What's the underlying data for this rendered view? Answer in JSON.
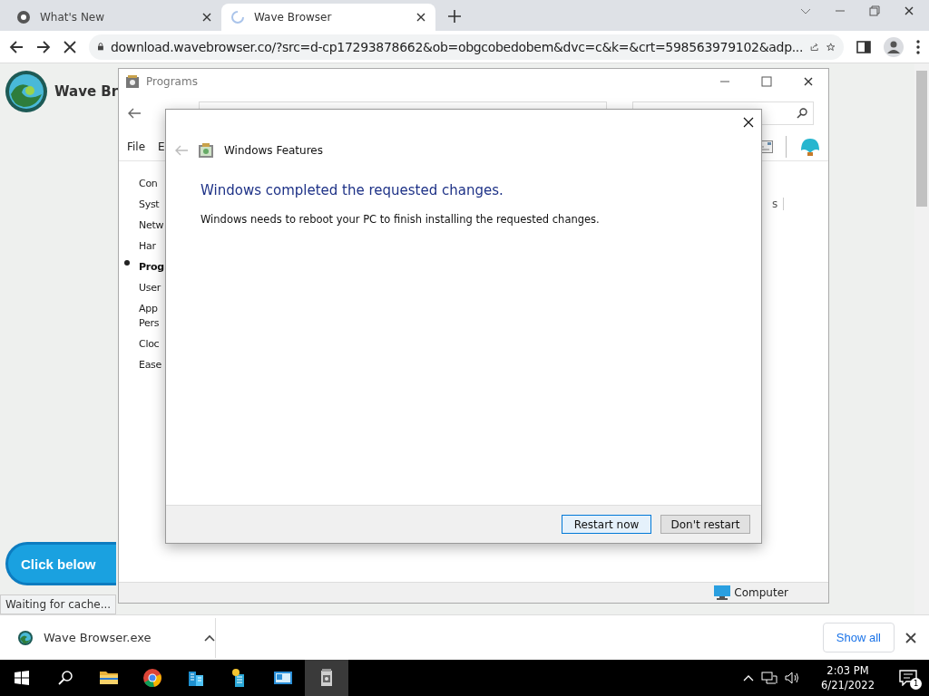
{
  "browser": {
    "tabs": [
      {
        "title": "What's New",
        "selected": false,
        "loading": false
      },
      {
        "title": "Wave Browser",
        "selected": true,
        "loading": true
      }
    ],
    "url": "download.wavebrowser.co/?src=d-cp17293878662&ob=obgcobedobem&dvc=c&k=&crt=598563979102&adp...",
    "page": {
      "brand": "Wave Br",
      "cta": "Click below",
      "status": "Waiting for cache..."
    }
  },
  "programs_window": {
    "title": "Programs",
    "menu": [
      "File",
      "E"
    ],
    "nav_items": [
      {
        "label": "Con",
        "selected": false
      },
      {
        "label": "Syst",
        "selected": false
      },
      {
        "label": "Netw",
        "selected": false
      },
      {
        "label": "Har",
        "selected": false
      },
      {
        "label": "Prog",
        "selected": true
      },
      {
        "label": "User",
        "selected": false
      },
      {
        "label": "App\nPers",
        "selected": false
      },
      {
        "label": "Cloc",
        "selected": false
      },
      {
        "label": "Ease",
        "selected": false
      }
    ],
    "fragment": "s",
    "status_bar": {
      "location": "Computer"
    }
  },
  "dialog": {
    "title": "Windows Features",
    "heading": "Windows completed the requested changes.",
    "message": "Windows needs to reboot your PC to finish installing the requested changes.",
    "buttons": [
      {
        "label": "Restart now",
        "default": true
      },
      {
        "label": "Don't restart",
        "default": false
      }
    ]
  },
  "downloads": {
    "file": "Wave Browser.exe",
    "show_all": "Show all"
  },
  "taskbar": {
    "apps": [
      {
        "kind": "explorer",
        "active": false
      },
      {
        "kind": "chrome",
        "active": false
      },
      {
        "kind": "server",
        "active": false
      },
      {
        "kind": "tower",
        "active": false
      },
      {
        "kind": "panel",
        "active": false
      },
      {
        "kind": "programs",
        "active": true
      }
    ],
    "time": "2:03 PM",
    "date": "6/21/2022",
    "notifications": "1"
  }
}
